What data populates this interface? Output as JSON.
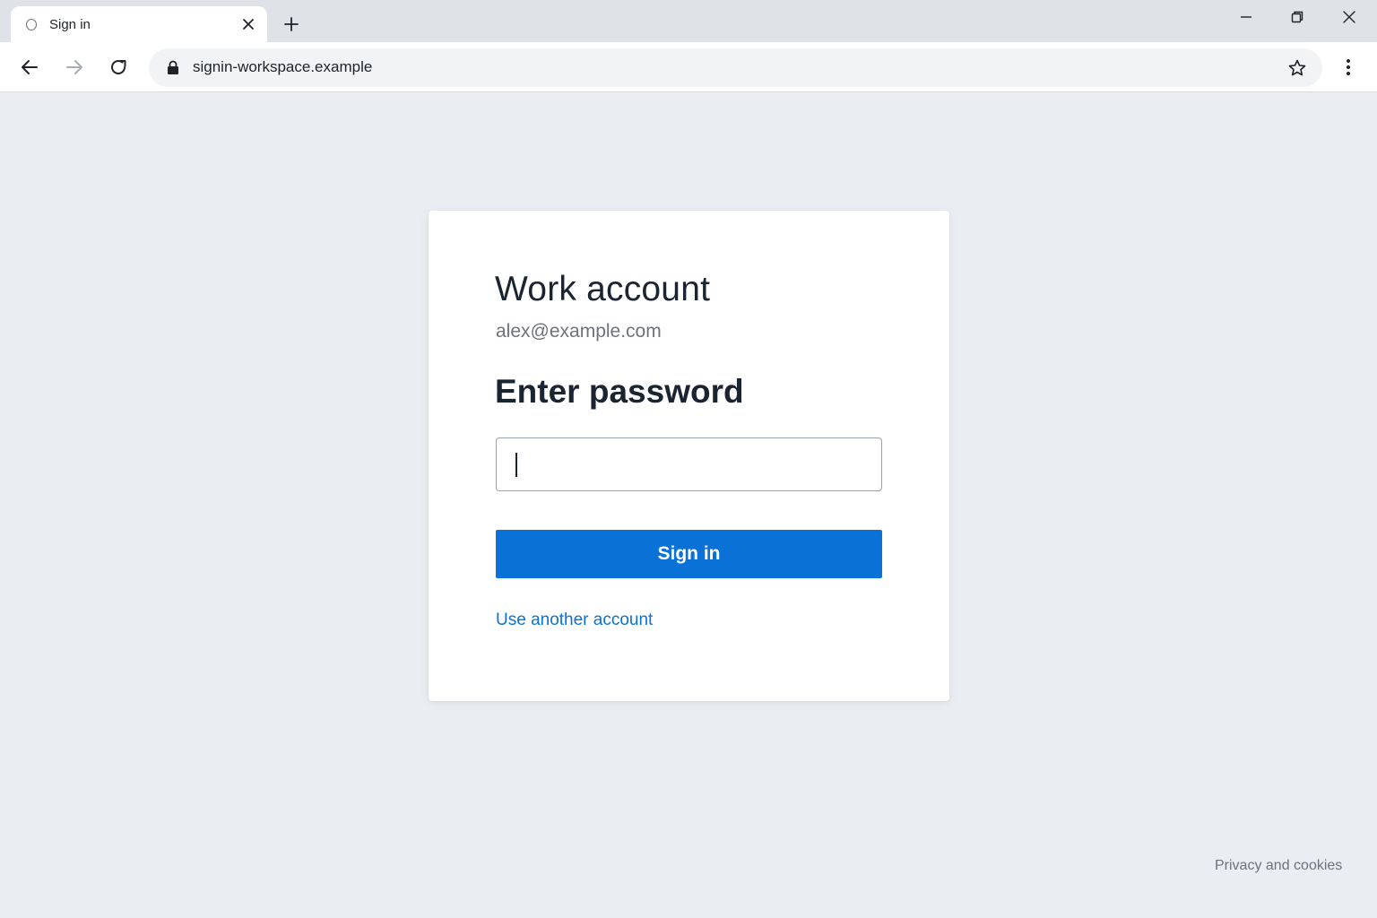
{
  "browser": {
    "tab": {
      "title": "Sign in",
      "favicon_icon": "circle-icon",
      "close_icon": "close-icon"
    },
    "new_tab_icon": "plus-icon",
    "window_controls": [
      "minimize-icon",
      "restore-icon",
      "close-icon"
    ],
    "toolbar": {
      "back_icon": "arrow-left-icon",
      "forward_icon": "arrow-right-icon",
      "reload_icon": "reload-icon",
      "url": "signin-workspace.example",
      "lock_icon": "lock-icon",
      "bookmark_icon": "star-icon",
      "menu_icon": "kebab-menu-icon"
    }
  },
  "signin": {
    "account_title": "Work account",
    "email": "alex@example.com",
    "heading": "Enter password",
    "password_value": "",
    "password_placeholder": "",
    "submit_label": "Sign in",
    "other_account_link": "Use another account"
  },
  "footer": {
    "privacy_link": "Privacy and cookies"
  },
  "colors": {
    "accent": "#0a72d6",
    "page_background": "#eaedf1",
    "heading_text": "#1b2431",
    "muted_text": "#6b737e"
  }
}
